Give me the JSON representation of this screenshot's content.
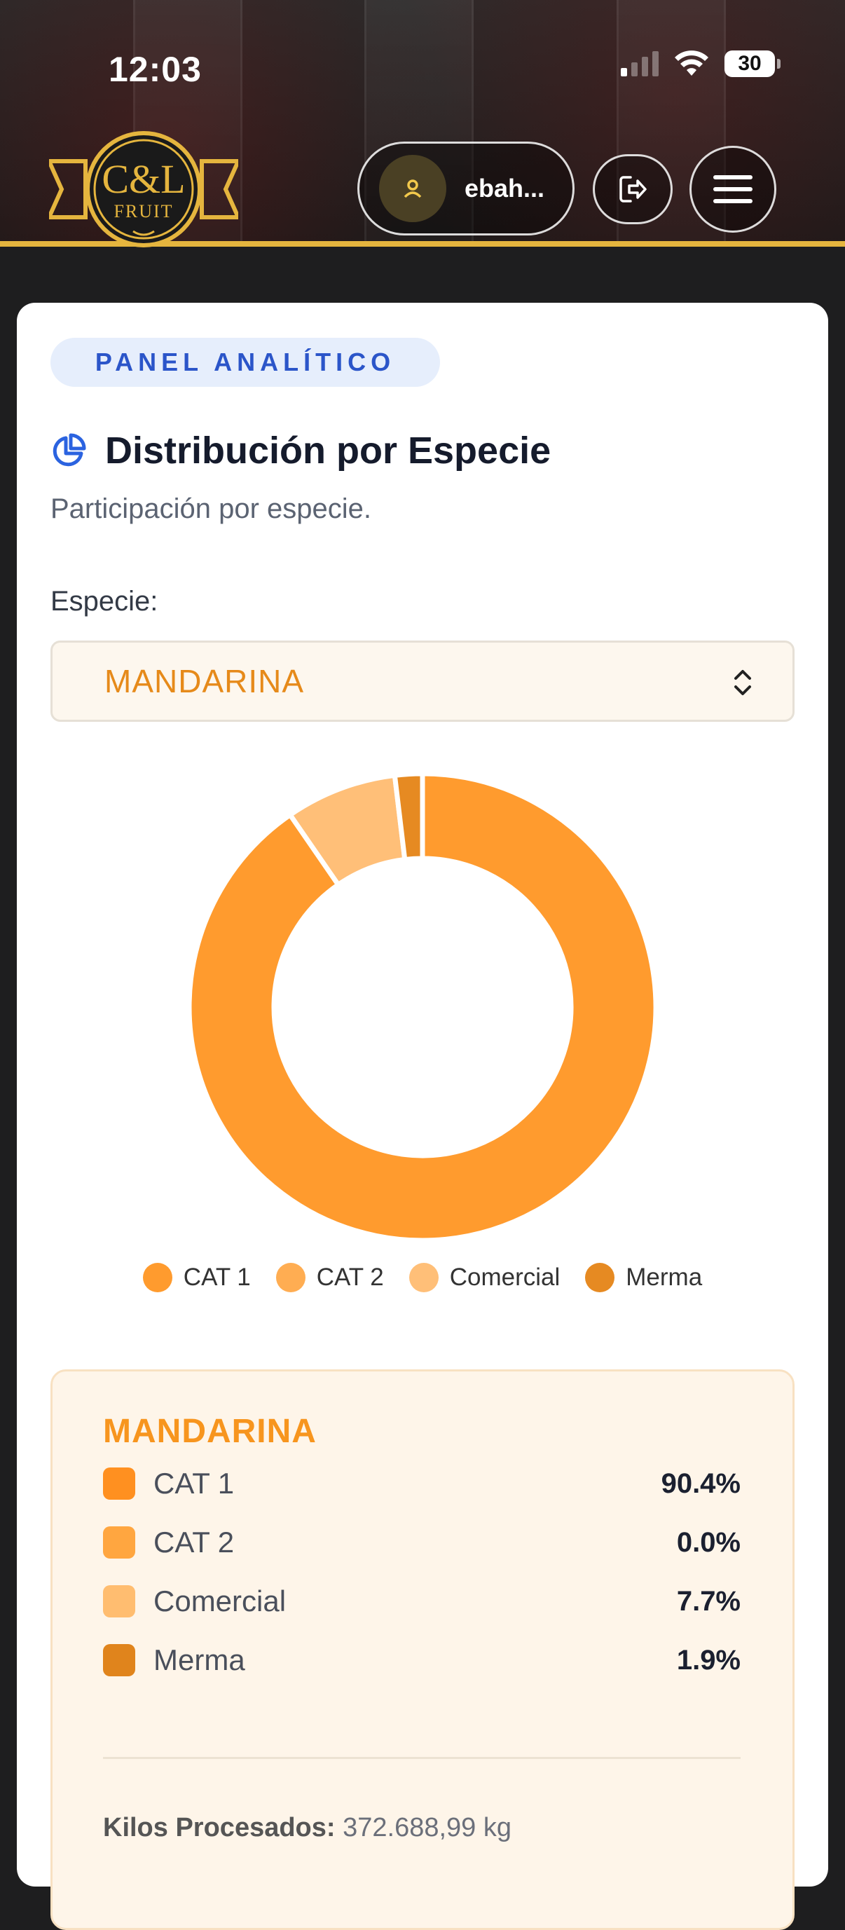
{
  "status_bar": {
    "time": "12:03",
    "battery": "30"
  },
  "header": {
    "logo_text": "C&L",
    "logo_subtext": "FRUIT",
    "username": "ebah...",
    "accent_color": "#e5b53e"
  },
  "panel": {
    "badge": "PANEL ANALÍTICO",
    "title": "Distribución por Especie",
    "subtitle": "Participación por especie.",
    "species_label": "Especie:",
    "species_selected": "MANDARINA"
  },
  "chart_data": {
    "type": "pie",
    "categories": [
      "CAT 1",
      "CAT 2",
      "Comercial",
      "Merma"
    ],
    "values": [
      90.4,
      0.0,
      7.7,
      1.9
    ],
    "colors": [
      "#ff9b2e",
      "#ffad52",
      "#ffbf78",
      "#e68a22"
    ],
    "style": "donut",
    "legend_position": "bottom"
  },
  "summary": {
    "title": "MANDARINA",
    "rows": [
      {
        "label": "CAT 1",
        "value": "90.4%",
        "color": "#ff9020"
      },
      {
        "label": "CAT 2",
        "value": "0.0%",
        "color": "#ffa640"
      },
      {
        "label": "Comercial",
        "value": "7.7%",
        "color": "#ffbd70"
      },
      {
        "label": "Merma",
        "value": "1.9%",
        "color": "#e0841c"
      }
    ],
    "kilos_label": "Kilos Procesados:",
    "kilos_value": "372.688,99 kg"
  }
}
